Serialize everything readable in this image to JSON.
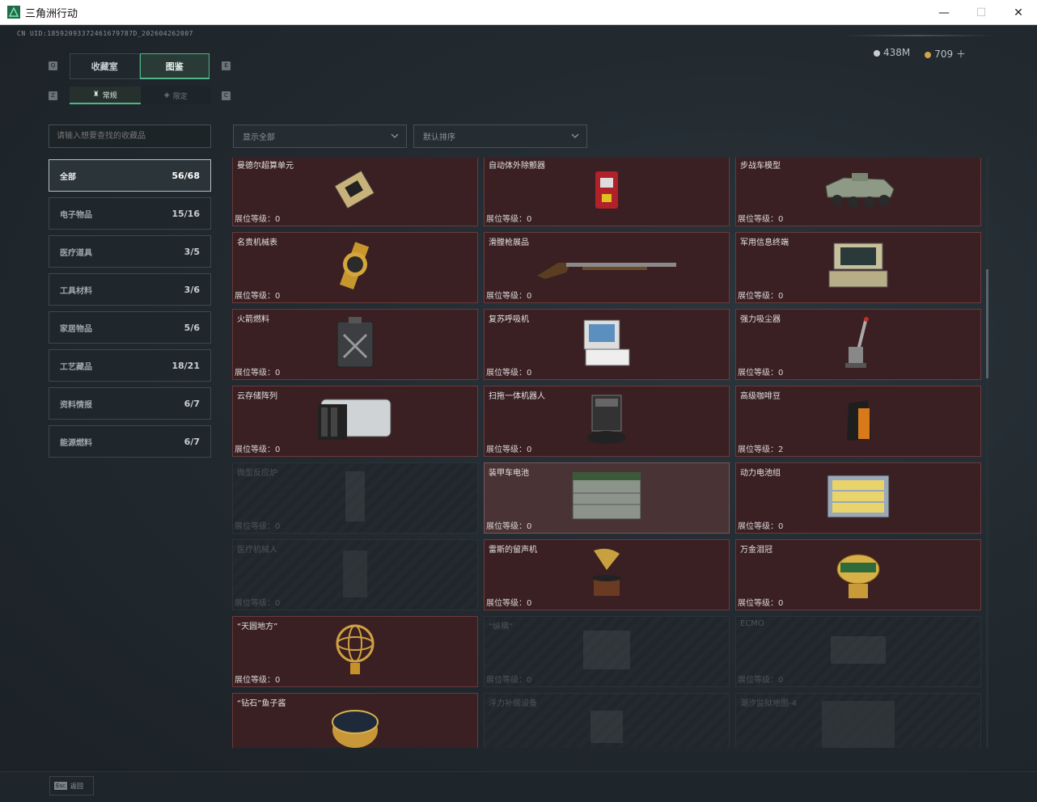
{
  "window": {
    "title": "三角洲行动",
    "minimize": "—",
    "maximize": "☐",
    "close": "✕"
  },
  "header": {
    "uid": "CN UID:18592093372461679787D_202604262007",
    "currency": [
      {
        "value": "438M",
        "color": "#c7ccd0"
      },
      {
        "value": "709 ＋",
        "color": "#d4a24a"
      }
    ]
  },
  "tabs": {
    "main": [
      {
        "label": "收藏室",
        "active": false
      },
      {
        "label": "图鉴",
        "active": true
      }
    ],
    "sub": [
      {
        "label": "常规",
        "active": true
      },
      {
        "label": "限定",
        "active": false
      }
    ],
    "keys": {
      "q": "Q",
      "e": "E",
      "z": "Z",
      "c": "C"
    }
  },
  "search": {
    "placeholder": "请输入想要查找的收藏品"
  },
  "filters": {
    "display": "显示全部",
    "sort": "默认排序"
  },
  "categories": [
    {
      "label": "全部",
      "count": "56/68",
      "active": true
    },
    {
      "label": "电子物品",
      "count": "15/16",
      "active": false
    },
    {
      "label": "医疗道具",
      "count": "3/5",
      "active": false
    },
    {
      "label": "工具材料",
      "count": "3/6",
      "active": false
    },
    {
      "label": "家居物品",
      "count": "5/6",
      "active": false
    },
    {
      "label": "工艺藏品",
      "count": "18/21",
      "active": false
    },
    {
      "label": "资料情报",
      "count": "6/7",
      "active": false
    },
    {
      "label": "能源燃料",
      "count": "6/7",
      "active": false
    }
  ],
  "level_label": "展位等级：",
  "items": [
    {
      "name": "曼德尔超算单元",
      "level": "0",
      "state": "owned",
      "icon": "circuit-board"
    },
    {
      "name": "自动体外除颤器",
      "level": "0",
      "state": "owned",
      "icon": "defibrillator"
    },
    {
      "name": "步战车模型",
      "level": "0",
      "state": "owned",
      "icon": "armored-vehicle"
    },
    {
      "name": "名贵机械表",
      "level": "0",
      "state": "owned",
      "icon": "watch"
    },
    {
      "name": "滑膛枪展品",
      "level": "0",
      "state": "owned",
      "icon": "musket"
    },
    {
      "name": "军用信息终端",
      "level": "0",
      "state": "owned",
      "icon": "terminal"
    },
    {
      "name": "火箭燃料",
      "level": "0",
      "state": "owned",
      "icon": "fuel-can"
    },
    {
      "name": "复苏呼吸机",
      "level": "0",
      "state": "owned",
      "icon": "ventilator"
    },
    {
      "name": "强力吸尘器",
      "level": "0",
      "state": "owned",
      "icon": "vacuum"
    },
    {
      "name": "云存储阵列",
      "level": "0",
      "state": "owned",
      "icon": "storage-array"
    },
    {
      "name": "扫拖一体机器人",
      "level": "0",
      "state": "owned",
      "icon": "robot-mop"
    },
    {
      "name": "高级咖啡豆",
      "level": "2",
      "state": "owned",
      "icon": "coffee-bag"
    },
    {
      "name": "微型反应炉",
      "level": "0",
      "state": "locked",
      "icon": "reactor"
    },
    {
      "name": "装甲车电池",
      "level": "0",
      "state": "highlight",
      "icon": "battery"
    },
    {
      "name": "动力电池组",
      "level": "0",
      "state": "owned",
      "icon": "battery-pack"
    },
    {
      "name": "医疗机械人",
      "level": "0",
      "state": "locked",
      "icon": "medical-robot"
    },
    {
      "name": "雷斯的留声机",
      "level": "0",
      "state": "owned",
      "icon": "gramophone"
    },
    {
      "name": "万金泪冠",
      "level": "0",
      "state": "owned",
      "icon": "jeweled-egg"
    },
    {
      "name": "“天圆地方”",
      "level": "0",
      "state": "owned",
      "icon": "armillary-sphere"
    },
    {
      "name": "“纵横”",
      "level": "0",
      "state": "locked",
      "icon": "chess-board"
    },
    {
      "name": "ECMO",
      "level": "0",
      "state": "locked",
      "icon": "ecmo"
    },
    {
      "name": "“钻石”鱼子酱",
      "level": "",
      "state": "owned",
      "icon": "caviar-tin"
    },
    {
      "name": "浮力补偿设备",
      "level": "",
      "state": "locked",
      "icon": "buoyancy"
    },
    {
      "name": "潮汐监狱地图-4",
      "level": "",
      "state": "locked",
      "icon": "map"
    }
  ],
  "footer": {
    "key": "Esc",
    "label": "返回"
  }
}
